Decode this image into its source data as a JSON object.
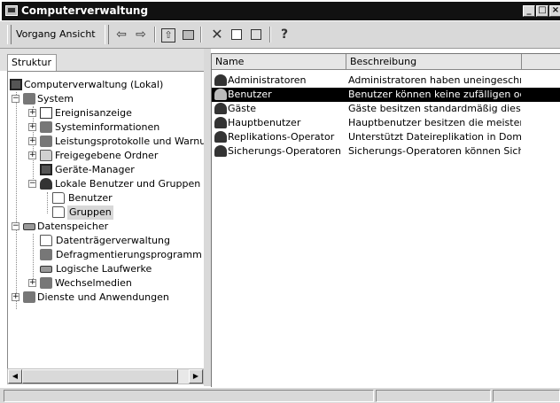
{
  "window": {
    "title": "Computerverwaltung"
  },
  "menu": {
    "vorgang": "Vorgang",
    "ansicht": "Ansicht"
  },
  "toolbar": {
    "back": "⇦",
    "forward": "⇨",
    "up": "⇧",
    "delete": "✕",
    "help": "?"
  },
  "tabs": {
    "struktur": "Struktur"
  },
  "tree": [
    {
      "label": "Computerverwaltung (Lokal)"
    },
    {
      "label": "System"
    },
    {
      "label": "Ereignisanzeige"
    },
    {
      "label": "Systeminformationen"
    },
    {
      "label": "Leistungsprotokolle und Warnung"
    },
    {
      "label": "Freigegebene Ordner"
    },
    {
      "label": "Geräte-Manager"
    },
    {
      "label": "Lokale Benutzer und Gruppen"
    },
    {
      "label": "Benutzer"
    },
    {
      "label": "Gruppen"
    },
    {
      "label": "Datenspeicher"
    },
    {
      "label": "Datenträgerverwaltung"
    },
    {
      "label": "Defragmentierungsprogramm"
    },
    {
      "label": "Logische Laufwerke"
    },
    {
      "label": "Wechselmedien"
    },
    {
      "label": "Dienste und Anwendungen"
    }
  ],
  "list": {
    "columns": {
      "name": "Name",
      "description": "Beschreibung"
    },
    "rows": [
      {
        "name": "Administratoren",
        "description": "Administratoren haben uneingeschrä..."
      },
      {
        "name": "Benutzer",
        "description": "Benutzer können keine zufälligen od..."
      },
      {
        "name": "Gäste",
        "description": "Gäste besitzen standardmäßig diesel..."
      },
      {
        "name": "Hauptbenutzer",
        "description": "Hauptbenutzer besitzen die meisten ..."
      },
      {
        "name": "Replikations-Operator",
        "description": "Unterstützt Dateireplikation in Domä..."
      },
      {
        "name": "Sicherungs-Operatoren",
        "description": "Sicherungs-Operatoren können Sich..."
      }
    ]
  }
}
